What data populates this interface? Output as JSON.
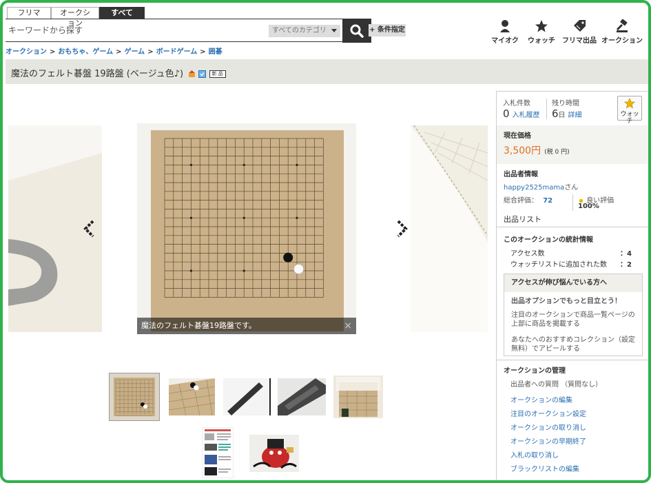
{
  "tabs": [
    "フリマ",
    "オークション",
    "すべて"
  ],
  "search": {
    "placeholder": "キーワードから探す",
    "category": "すべてのカテゴリ",
    "condition_button": "+ 条件指定"
  },
  "header_icons": [
    {
      "label": "マイオク",
      "icon": "person-icon"
    },
    {
      "label": "ウォッチ",
      "icon": "star-icon"
    },
    {
      "label": "フリマ出品",
      "icon": "tag-icon"
    },
    {
      "label": "オークション",
      "icon": "gavel-icon"
    }
  ],
  "breadcrumb": [
    "オークション",
    "おもちゃ、ゲーム",
    "ゲーム",
    "ボードゲーム",
    "囲碁"
  ],
  "breadcrumb_sep": ">",
  "item": {
    "title": "魔法のフェルト碁盤 19路盤 (ベージュ色♪)",
    "badge_new": "新 品",
    "caption": "魔法のフェルト碁盤19路盤です。",
    "caption_close": "×"
  },
  "colors": {
    "accent_green": "#2fb34a",
    "price_orange": "#e0701f",
    "link_blue": "#2a6fb2",
    "felt_beige": "#cbb28a"
  },
  "sidebar": {
    "bids_label": "入札件数",
    "bids_value": "0",
    "bid_history": "入札履歴",
    "time_label": "残り時間",
    "time_value": "6",
    "time_unit": "日",
    "time_detail": "詳細",
    "watch_button": "ウォッチ",
    "current_price_label": "現在価格",
    "price": "3,500円",
    "tax": "(税 0 円)",
    "seller_heading": "出品者情報",
    "seller_name": "happy2525mama",
    "seller_suffix": "さん",
    "rating_label": "総合評価：",
    "rating_value": "72",
    "good_rating_label": "良い評価",
    "good_rating_value": "100%",
    "listing_link": "出品リスト",
    "stats_heading": "このオークションの統計情報",
    "stats": [
      {
        "label": "アクセス数",
        "value": "：4"
      },
      {
        "label": "ウォッチリストに追加された数",
        "value": "：2"
      }
    ],
    "promo_heading": "アクセスが伸び悩んでいる方へ",
    "promo_title": "出品オプションでもっと目立とう！",
    "promo_items": [
      "注目のオークションで商品一覧ページの上部に商品を掲載する",
      "あなたへのおすすめコレクション（設定無料）でアピールする"
    ],
    "mgmt_heading": "オークションの管理",
    "mgmt_note": "出品者への質問 （質問なし）",
    "mgmt_links": [
      "オークションの編集",
      "注目のオークション設定",
      "オークションの取り消し",
      "オークションの早期終了",
      "入札の取り消し",
      "ブラックリストの編集"
    ]
  }
}
